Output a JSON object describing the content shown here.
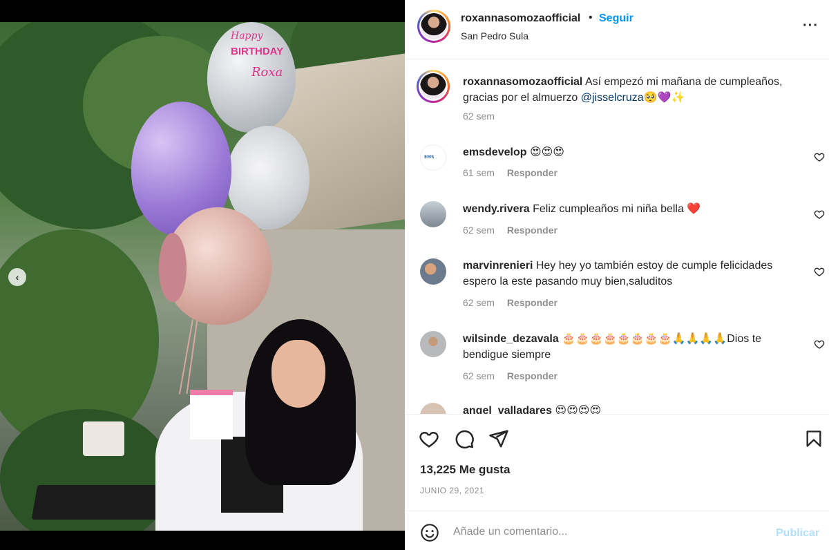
{
  "post": {
    "username": "roxannasomozaofficial",
    "dot": "•",
    "follow_label": "Seguir",
    "location": "San Pedro Sula",
    "more_label": "···"
  },
  "photo": {
    "balloon_text_1": "Happy",
    "balloon_text_2": "BIRTHDAY",
    "balloon_text_3": "Roxa",
    "carousel_prev": "‹"
  },
  "caption": {
    "username": "roxannasomozaofficial",
    "text": "Así empezó mi mañana de cumpleaños, gracias por el almuerzo ",
    "mention": "@jisselcruza",
    "emojis": "🥺💜✨",
    "time": "62 sem"
  },
  "comments": [
    {
      "username": "emsdevelop",
      "text": "😍😍😍",
      "time": "61 sem",
      "reply": "Responder"
    },
    {
      "username": "wendy.rivera",
      "text": "Feliz cumpleaños mi niña bella ❤️",
      "time": "62 sem",
      "reply": "Responder"
    },
    {
      "username": "marvinrenieri",
      "text": "Hey hey yo también estoy de cumple felicidades espero la este pasando muy bien,saluditos",
      "time": "62 sem",
      "reply": "Responder"
    },
    {
      "username": "wilsinde_dezavala",
      "text": "🎂🎂🎂🎂🎂🎂🎂🎂🙏🙏🙏🙏Dios te bendigue siempre",
      "time": "62 sem",
      "reply": "Responder"
    },
    {
      "username": "angel_valladares",
      "text": "😍😍😍😍",
      "time": "",
      "reply": ""
    }
  ],
  "actions": {
    "likes": "13,225 Me gusta",
    "date": "JUNIO 29, 2021"
  },
  "add_comment": {
    "placeholder": "Añade un comentario...",
    "publish_label": "Publicar"
  }
}
